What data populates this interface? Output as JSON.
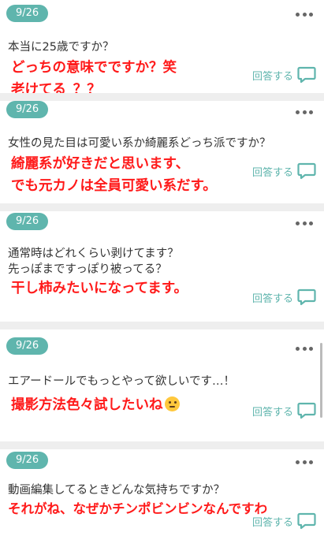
{
  "reply_label": "回答する",
  "colors": {
    "accent": "#5fb5ad",
    "answer": "#ff1a1a"
  },
  "posts": [
    {
      "date": "9/26",
      "question": [
        "本当に25歳ですか？"
      ],
      "answer": [
        "どっちの意味でですか？笑",
        "老けてる_？？"
      ]
    },
    {
      "date": "9/26",
      "question": [
        "女性の見た目は可愛い系か綺麗系どっち派ですか？"
      ],
      "answer": [
        "綺麗系が好きだと思います、",
        "でも元カノは全員可愛い系だす。"
      ]
    },
    {
      "date": "9/26",
      "question": [
        "通常時はどれくらい剥けてます？",
        "先っぽまですっぽり被ってる？"
      ],
      "answer": [
        "干し柿みたいになってます。"
      ]
    },
    {
      "date": "9/26",
      "question": [
        "エアードールでもっとやって欲しいです…！"
      ],
      "answer": [
        "撮影方法色々試したいね"
      ]
    },
    {
      "date": "9/26",
      "question": [
        "動画編集してるときどんな気持ちですか？"
      ],
      "answer": [
        "それがね、なぜかチンポビンビンなんですわ"
      ]
    }
  ]
}
